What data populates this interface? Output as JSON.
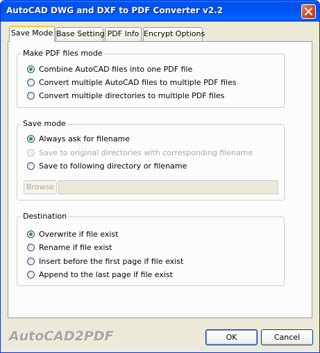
{
  "window": {
    "title": "AutoCAD DWG and DXF to PDF Converter v2.2"
  },
  "tabs": [
    {
      "label": "Save Mode",
      "active": true
    },
    {
      "label": "Base Setting",
      "active": false
    },
    {
      "label": "PDF Info",
      "active": false
    },
    {
      "label": "Encrypt Options",
      "active": false
    }
  ],
  "make_pdf_mode": {
    "legend": "Make PDF files mode",
    "options": [
      {
        "label": "Combine AutoCAD files into one PDF file",
        "checked": true,
        "enabled": true
      },
      {
        "label": "Convert multiple AutoCAD files to multiple PDF files",
        "checked": false,
        "enabled": true
      },
      {
        "label": "Convert multiple directories to multiple PDF files",
        "checked": false,
        "enabled": true
      }
    ]
  },
  "save_mode": {
    "legend": "Save mode",
    "options": [
      {
        "label": "Always ask for filename",
        "checked": true,
        "enabled": true
      },
      {
        "label": "Save to original directories with corresponding filename",
        "checked": false,
        "enabled": false
      },
      {
        "label": "Save to following directory or filename",
        "checked": false,
        "enabled": true
      }
    ],
    "browse_label": "Browse",
    "path_value": ""
  },
  "destination": {
    "legend": "Destination",
    "options": [
      {
        "label": "Overwrite if file exist",
        "checked": true,
        "enabled": true
      },
      {
        "label": "Rename if file exist",
        "checked": false,
        "enabled": true
      },
      {
        "label": "Insert before the first page if file exist",
        "checked": false,
        "enabled": true
      },
      {
        "label": "Append to the last page if file exist",
        "checked": false,
        "enabled": true
      }
    ]
  },
  "footer": {
    "brand": "AutoCAD2PDF",
    "ok_label": "OK",
    "cancel_label": "Cancel"
  },
  "colors": {
    "titlebar": "#0054e3",
    "dialog_bg": "#ece9d8",
    "radio_dot": "#21a121",
    "active_tab_highlight": "#ffc83c"
  }
}
